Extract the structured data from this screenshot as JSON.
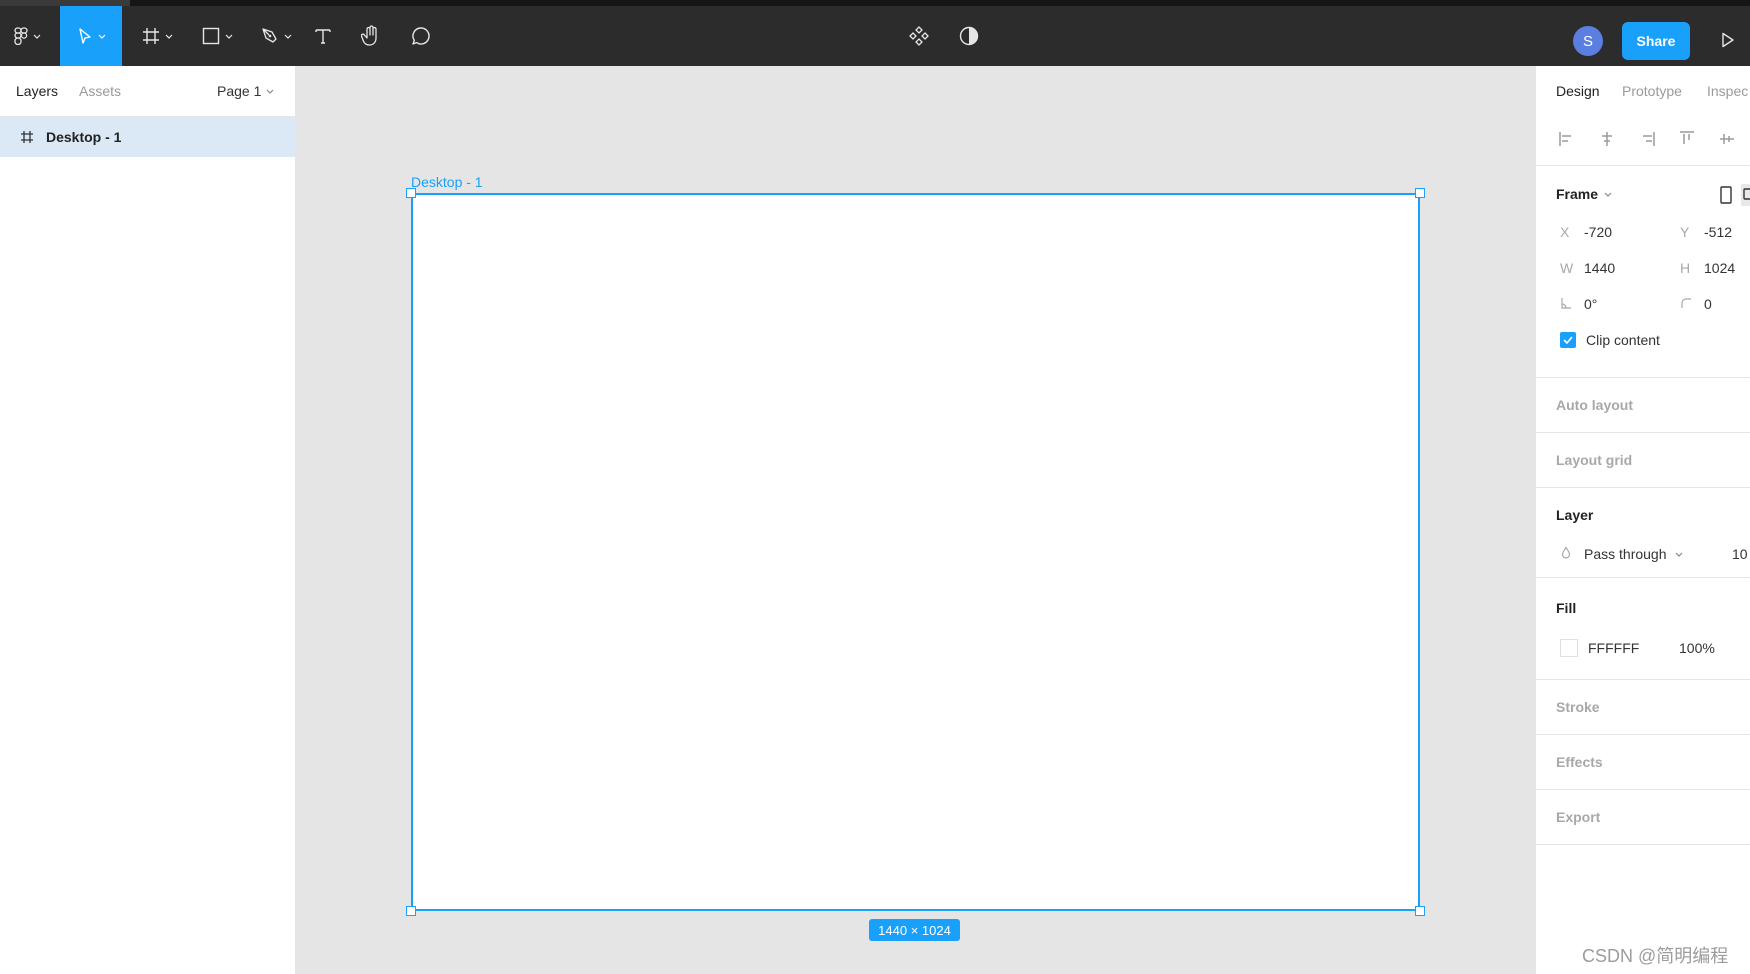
{
  "toolbar": {
    "share_label": "Share",
    "avatar_initial": "S"
  },
  "left_panel": {
    "tabs": [
      "Layers",
      "Assets"
    ],
    "page_select": "Page 1",
    "layers": [
      {
        "name": "Desktop - 1",
        "selected": true
      }
    ]
  },
  "canvas": {
    "frame_label": "Desktop - 1",
    "size_badge": "1440 × 1024"
  },
  "right_panel": {
    "tabs": [
      "Design",
      "Prototype",
      "Inspec"
    ],
    "frame": {
      "title": "Frame",
      "x_label": "X",
      "x_value": "-720",
      "y_label": "Y",
      "y_value": "-512",
      "w_label": "W",
      "w_value": "1440",
      "h_label": "H",
      "h_value": "1024",
      "rotation_value": "0°",
      "radius_value": "0",
      "clip_content_label": "Clip content",
      "clip_content_checked": true
    },
    "auto_layout": "Auto layout",
    "layout_grid": "Layout grid",
    "layer": {
      "title": "Layer",
      "blend_mode": "Pass through",
      "opacity_partial": "10"
    },
    "fill": {
      "title": "Fill",
      "hex": "FFFFFF",
      "opacity": "100%"
    },
    "stroke": "Stroke",
    "effects": "Effects",
    "export": "Export"
  },
  "watermark": "CSDN @简明编程",
  "colors": {
    "accent": "#18a0fb",
    "toolbar_bg": "#2c2c2c",
    "canvas_bg": "#e5e5e5",
    "selection_bg": "#dbe9f7"
  }
}
